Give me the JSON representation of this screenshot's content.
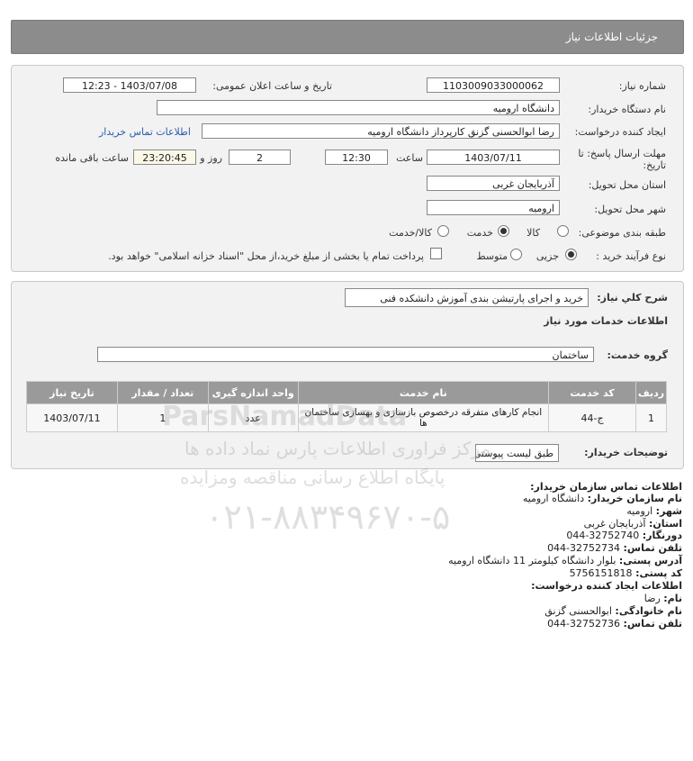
{
  "header": {
    "title": "جزئیات اطلاعات نیاز"
  },
  "form": {
    "need_number_label": "شماره نیاز:",
    "need_number": "1103009033000062",
    "announce_label": "تاریخ و ساعت اعلان عمومی:",
    "announce_value": "1403/07/08 - 12:23",
    "buyer_org_label": "نام دستگاه خریدار:",
    "buyer_org": "دانشگاه ارومیه",
    "creator_label": "ایجاد کننده درخواست:",
    "creator": "رضا ابوالحسنی گزنق کارپرداز دانشگاه ارومیه",
    "contact_link": "اطلاعات تماس خریدار",
    "deadline_label_1": "مهلت ارسال پاسخ: تا",
    "deadline_label_2": "تاریخ:",
    "deadline_date": "1403/07/11",
    "time_label": "ساعت",
    "deadline_time": "12:30",
    "days_value": "2",
    "days_label": "روز و",
    "remaining_time": "23:20:45",
    "remaining_label": "ساعت باقی مانده",
    "province_label": "استان محل تحویل:",
    "province": "آذربایجان غربی",
    "city_label": "شهر محل تحویل:",
    "city": "ارومیه",
    "category_label": "طبقه بندی موضوعی:",
    "category_options": [
      "کالا",
      "خدمت",
      "کالا/خدمت"
    ],
    "category_selected": "خدمت",
    "process_label": "نوع فرآیند خرید :",
    "process_options": [
      "جزیی",
      "متوسط"
    ],
    "process_selected": "جزیی",
    "payment_note": "پرداخت تمام یا بخشی از مبلغ خرید،از محل \"اسناد خزانه اسلامی\" خواهد بود."
  },
  "summary": {
    "description_label": "شرح كلي نياز:",
    "description": "خرید و اجرای پارتیشن بندی آموزش دانشکده فنی",
    "services_heading": "اطلاعات خدمات مورد نیاز",
    "service_group_label": "گروه خدمت:",
    "service_group": "ساختمان",
    "table": {
      "headers": [
        "ردیف",
        "کد خدمت",
        "نام خدمت",
        "واحد اندازه گیری",
        "تعداد / مقدار",
        "تاریخ نیاز"
      ],
      "rows": [
        {
          "row": "1",
          "code": "ج-44",
          "name": "انجام کارهای متفرقه درخصوص بازسازی و بهسازی ساختمان ها",
          "unit": "عدد",
          "qty": "1",
          "date": "1403/07/11"
        }
      ]
    },
    "buyer_notes_label": "توضیحات خریدار:",
    "buyer_notes": "طبق لیست پیوستی"
  },
  "contact": {
    "heading": "اطلاعات تماس سازمان خریدار:",
    "org_label": "نام سازمان خریدار:",
    "org": "دانشگاه ارومیه",
    "city_label": "شهر:",
    "city": "ارومیه",
    "province_label": "استان:",
    "province": "آذربایجان غربی",
    "fax_label": "دورنگار:",
    "fax": "044-32752740",
    "phone_label": "تلفن تماس:",
    "phone": "044-32752734",
    "address_label": "آدرس پستی:",
    "address": "بلوار دانشگاه کیلومتر 11 دانشگاه ارومیه",
    "postal_label": "کد پستی:",
    "postal": "5756151818",
    "creator_heading": "اطلاعات ایجاد کننده درخواست:",
    "first_name_label": "نام:",
    "first_name": "رضا",
    "last_name_label": "نام خانوادگی:",
    "last_name": "ابوالحسنی گزنق",
    "creator_phone_label": "تلفن تماس:",
    "creator_phone": "044-32752736"
  },
  "watermark": {
    "line1": "ParsNamadData",
    "line2": "مرکز فراوری اطلاعات پارس نماد داده ها",
    "line3": "پایگاه اطلاع رسانی مناقصه ومزایده",
    "line4": "۰۲۱-۸۸۳۴۹۶۷۰-۵"
  }
}
